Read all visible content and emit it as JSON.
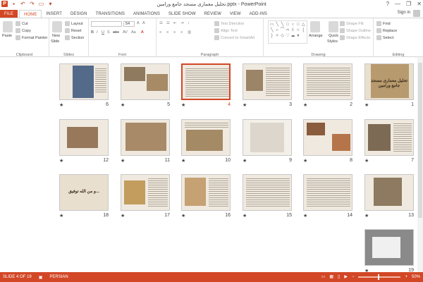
{
  "window": {
    "title": "تحلیل معماری مسجد جامع ورامین.pptx - PowerPoint",
    "controls": [
      "?",
      "—",
      "❐",
      "✕"
    ]
  },
  "tabs": [
    {
      "label": "FILE",
      "kind": "file"
    },
    {
      "label": "HOME",
      "kind": "active"
    },
    {
      "label": "INSERT"
    },
    {
      "label": "DESIGN"
    },
    {
      "label": "TRANSITIONS"
    },
    {
      "label": "ANIMATIONS"
    },
    {
      "label": "SLIDE SHOW"
    },
    {
      "label": "REVIEW"
    },
    {
      "label": "VIEW"
    },
    {
      "label": "ADD-INS"
    }
  ],
  "account": {
    "signin": "Sign in"
  },
  "ribbon": {
    "clipboard": {
      "label": "Clipboard",
      "paste": "Paste",
      "cut": "Cut",
      "copy": "Copy",
      "format_painter": "Format Painter"
    },
    "slides": {
      "label": "Slides",
      "new_slide": "New",
      "new_slide2": "Slide",
      "layout": "Layout",
      "reset": "Reset",
      "section": "Section"
    },
    "font": {
      "label": "Font",
      "size": "54"
    },
    "paragraph": {
      "label": "Paragraph",
      "text_direction": "Text Direction",
      "align_text": "Align Text",
      "convert_smartart": "Convert to SmartArt"
    },
    "drawing": {
      "label": "Drawing",
      "arrange": "Arrange",
      "quick_styles": "Quick",
      "quick_styles2": "Styles",
      "shape_fill": "Shape Fill",
      "shape_outline": "Shape Outline",
      "shape_effects": "Shape Effects"
    },
    "editing": {
      "label": "Editing",
      "find": "Find",
      "replace": "Replace",
      "select": "Select"
    }
  },
  "slides": [
    {
      "n": "1"
    },
    {
      "n": "2"
    },
    {
      "n": "3"
    },
    {
      "n": "4",
      "selected": true
    },
    {
      "n": "5"
    },
    {
      "n": "6"
    },
    {
      "n": "7"
    },
    {
      "n": "8"
    },
    {
      "n": "9"
    },
    {
      "n": "10"
    },
    {
      "n": "11"
    },
    {
      "n": "12"
    },
    {
      "n": "13"
    },
    {
      "n": "14"
    },
    {
      "n": "15"
    },
    {
      "n": "16"
    },
    {
      "n": "17"
    },
    {
      "n": "18"
    },
    {
      "n": "19"
    }
  ],
  "slide_text": {
    "s1": "تحلیل معماری مسجد جامع ورامین",
    "s18": "و من الله توفیق..."
  },
  "status": {
    "slide": "SLIDE 4 OF 19",
    "language": "PERSIAN",
    "zoom": "50%",
    "minus": "−",
    "plus": "+"
  },
  "colors": {
    "accent": "#d24726"
  }
}
